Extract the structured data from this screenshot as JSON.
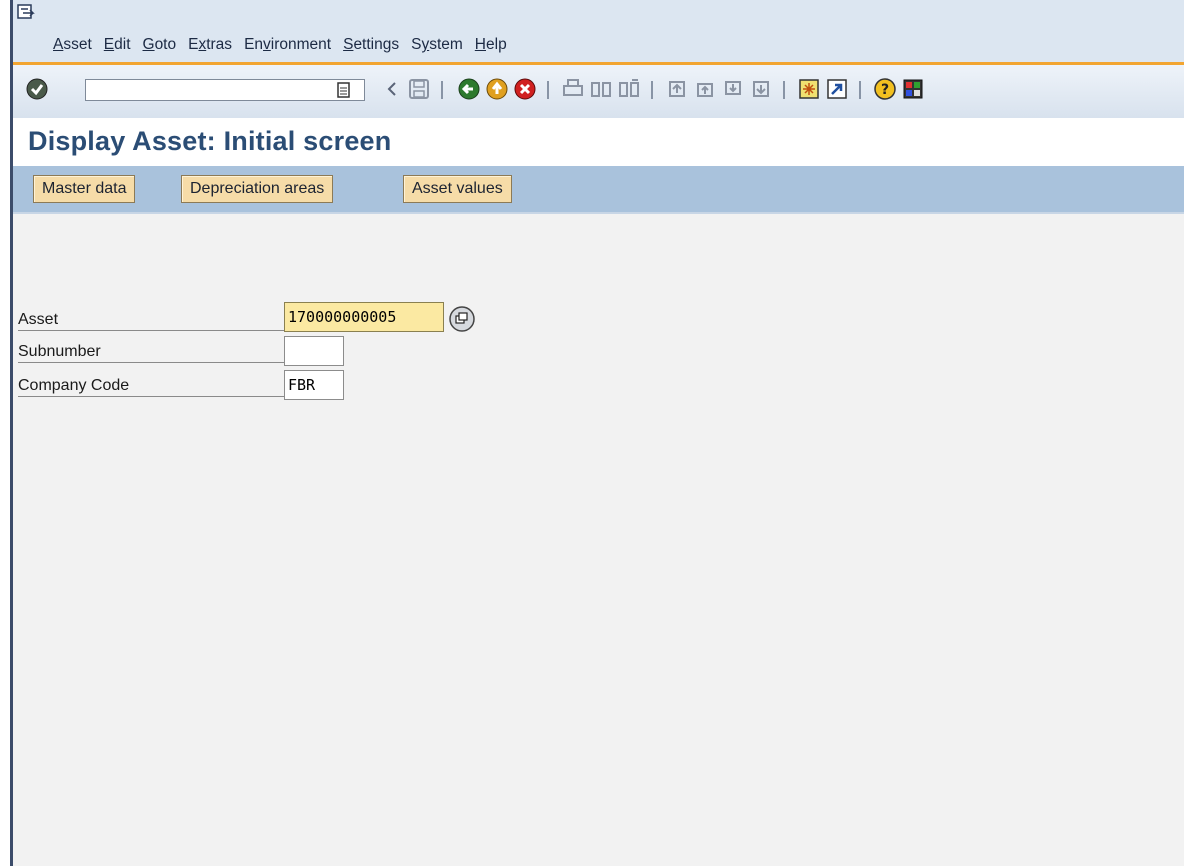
{
  "menu": {
    "items": [
      {
        "pre": "",
        "ul": "A",
        "post": "sset"
      },
      {
        "pre": "",
        "ul": "E",
        "post": "dit"
      },
      {
        "pre": "",
        "ul": "G",
        "post": "oto"
      },
      {
        "pre": "E",
        "ul": "x",
        "post": "tras"
      },
      {
        "pre": "En",
        "ul": "v",
        "post": "ironment"
      },
      {
        "pre": "",
        "ul": "S",
        "post": "ettings"
      },
      {
        "pre": "S",
        "ul": "y",
        "post": "stem"
      },
      {
        "pre": "",
        "ul": "H",
        "post": "elp"
      }
    ]
  },
  "toolbar": {
    "command_field_value": ""
  },
  "page": {
    "title": "Display Asset: Initial screen"
  },
  "app_toolbar": {
    "buttons": [
      "Master data",
      "Depreciation areas",
      "Asset values"
    ]
  },
  "form": {
    "asset_label": "Asset",
    "asset_value": "170000000005",
    "subnumber_label": "Subnumber",
    "subnumber_value": "",
    "company_code_label": "Company Code",
    "company_code_value": "FBR"
  },
  "colors": {
    "title": "#2b4d75",
    "toolbar_accent": "#f2a530",
    "app_toolbar_bg": "#a9c2dc",
    "button_bg": "#f6dca8",
    "required_field_bg": "#fbe9a2"
  }
}
